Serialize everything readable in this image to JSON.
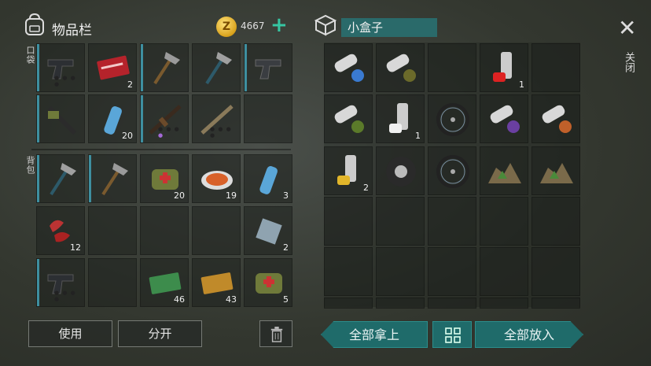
{
  "inventory": {
    "title": "物品栏",
    "coin_symbol": "Z",
    "coins": "4667",
    "add_label": "+",
    "pocket_label": "口袋",
    "backpack_label": "背包",
    "use_button": "使用",
    "split_button": "分开",
    "pocket_qty": {
      "coupon_red": "2",
      "water": "20"
    },
    "backpack_qty": {
      "medkit": "20",
      "food": "19",
      "water": "3",
      "meat": "12",
      "metal": "2",
      "coupon_green": "46",
      "coupon_gold": "43",
      "medbag": "5"
    }
  },
  "container": {
    "title": "小盒子",
    "take_all_button": "全部拿上",
    "put_all_button": "全部放入",
    "close_label": "关闭",
    "qty": {
      "spray_red": "1",
      "spray_white": "1",
      "spray_yellow": "2"
    }
  },
  "colors": {
    "accent_teal": "#1f6b6a",
    "plus_green": "#36c6a2",
    "stripe_blue": "#3e8fa0"
  },
  "icons": [
    "backpack-icon",
    "coin-icon",
    "plus-icon",
    "box-icon",
    "close-icon",
    "trash-icon",
    "sort-grid-icon"
  ]
}
